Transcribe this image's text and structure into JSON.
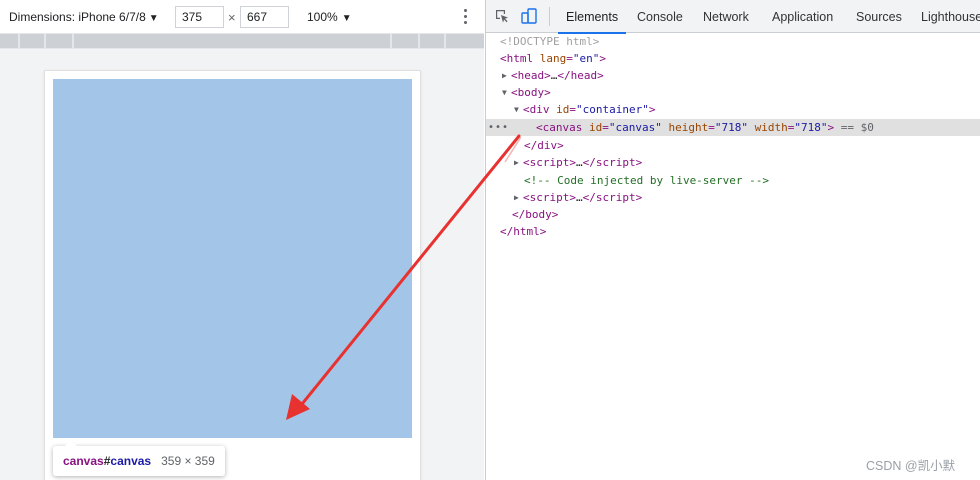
{
  "device_toolbar": {
    "dimensions_label": "Dimensions: iPhone 6/7/8",
    "width_value": "375",
    "height_value": "667",
    "times_sign": "×",
    "zoom_label": "100%"
  },
  "tooltip": {
    "tag": "canvas",
    "hash": "#",
    "id": "canvas",
    "size": "359 × 359"
  },
  "devtools": {
    "tabs": [
      "Elements",
      "Console",
      "Network",
      "Application",
      "Sources",
      "Lighthouse"
    ],
    "active_tab": "Elements",
    "dom": {
      "doctype": "<!DOCTYPE html>",
      "html_tag": "html",
      "html_lang_attr": "lang",
      "html_lang_val": "\"en\"",
      "head_collapsed": "head",
      "body_tag": "body",
      "div_tag": "div",
      "div_id_attr": "id",
      "div_id_val": "\"container\"",
      "canvas_tag": "canvas",
      "canvas_id_attr": "id",
      "canvas_id_val": "\"canvas\"",
      "canvas_height_attr": "height",
      "canvas_height_val": "\"718\"",
      "canvas_width_attr": "width",
      "canvas_width_val": "\"718\"",
      "selected_ref": "== $0",
      "script_tag": "script",
      "comment": "<!-- Code injected by live-server -->",
      "ellipsis": "…"
    }
  },
  "watermark": "CSDN @凯小默",
  "colors": {
    "canvas_fill": "#a3c5e8",
    "arrow": "#e8322f",
    "active_tab_underline": "#1a73e8"
  }
}
